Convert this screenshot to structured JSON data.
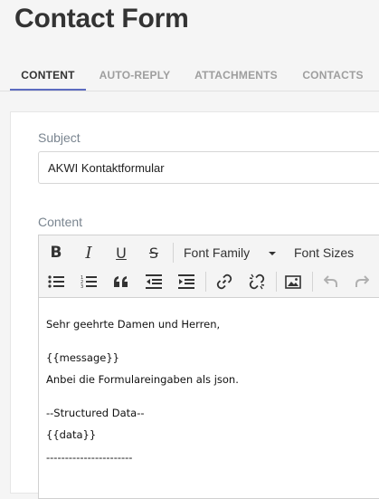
{
  "page": {
    "title": "Contact Form"
  },
  "tabs": [
    {
      "label": "CONTENT",
      "active": true
    },
    {
      "label": "AUTO-REPLY",
      "active": false
    },
    {
      "label": "ATTACHMENTS",
      "active": false
    },
    {
      "label": "CONTACTS",
      "active": false
    }
  ],
  "colors": {
    "accent": "#5c6bc0",
    "title": "#333333",
    "tab_inactive": "#9e9e9e",
    "label": "#7a8590"
  },
  "subject": {
    "label": "Subject",
    "value": "AKWI Kontaktformular"
  },
  "content": {
    "label": "Content",
    "toolbar": {
      "bold": "B",
      "italic": "I",
      "underline": "U",
      "strikethrough": "S",
      "font_family": "Font Family",
      "font_sizes": "Font Sizes",
      "icons": [
        "bullet-list-icon",
        "numbered-list-icon",
        "blockquote-icon",
        "outdent-icon",
        "indent-icon",
        "link-icon",
        "unlink-icon",
        "image-icon",
        "undo-icon",
        "redo-icon"
      ]
    },
    "lines": [
      "Sehr geehrte Damen und Herren,",
      "",
      "{{message}}",
      "Anbei die Formulareingaben als json.",
      "",
      "--Structured Data--",
      "{{data}}",
      "-----------------------"
    ]
  }
}
